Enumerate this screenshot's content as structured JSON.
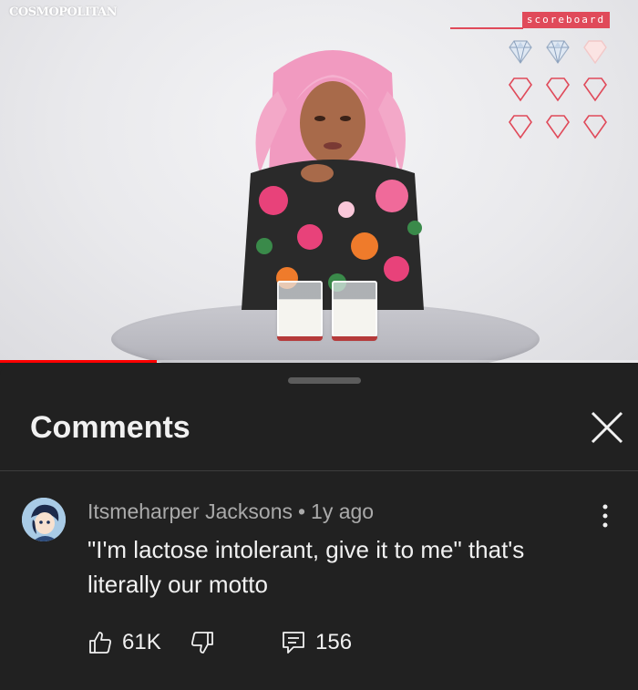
{
  "video": {
    "brand_logo": "COSMOPOLITAN",
    "scoreboard_label": "scoreboard",
    "scoreboard_gems": [
      {
        "state": "filled"
      },
      {
        "state": "filled"
      },
      {
        "state": "empty-pale"
      },
      {
        "state": "outline"
      },
      {
        "state": "outline"
      },
      {
        "state": "outline"
      },
      {
        "state": "outline"
      },
      {
        "state": "outline"
      },
      {
        "state": "outline"
      }
    ],
    "progress_fraction": 0.245,
    "colors": {
      "accent": "#e04a5a",
      "progress": "#ff0000"
    }
  },
  "comments_sheet": {
    "title": "Comments",
    "close_icon": "close-icon"
  },
  "comment": {
    "author": "Itsmeharper Jacksons",
    "separator": "•",
    "time": "1y ago",
    "text": "\"I'm lactose intolerant, give it to me\"  that's literally our motto",
    "likes": "61K",
    "replies": "156",
    "icons": {
      "like": "thumbs-up-icon",
      "dislike": "thumbs-down-icon",
      "reply": "reply-icon",
      "more": "more-vert-icon"
    }
  }
}
